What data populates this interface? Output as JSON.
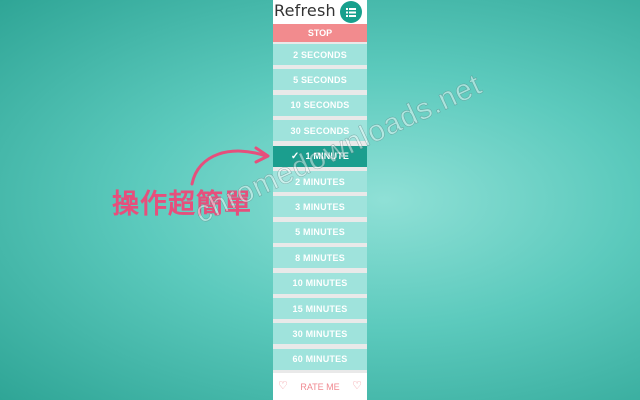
{
  "header": {
    "title": "Refresh",
    "menu_icon": "list-icon"
  },
  "stop_label": "STOP",
  "intervals": [
    {
      "label": "2 SECONDS",
      "active": false
    },
    {
      "label": "5 SECONDS",
      "active": false
    },
    {
      "label": "10 SECONDS",
      "active": false
    },
    {
      "label": "30 SECONDS",
      "active": false
    },
    {
      "label": "1 MINUTE",
      "active": true
    },
    {
      "label": "2 MINUTES",
      "active": false
    },
    {
      "label": "3 MINUTES",
      "active": false
    },
    {
      "label": "5 MINUTES",
      "active": false
    },
    {
      "label": "8 MINUTES",
      "active": false
    },
    {
      "label": "10 MINUTES",
      "active": false
    },
    {
      "label": "15 MINUTES",
      "active": false
    },
    {
      "label": "30 MINUTES",
      "active": false
    },
    {
      "label": "60 MINUTES",
      "active": false
    }
  ],
  "footer": {
    "rate_label": "RATE ME",
    "icon": "heart-icon"
  },
  "side_caption": "操作超簡單",
  "watermark": "chromedownloads.net",
  "colors": {
    "accent": "#17a08d",
    "stop": "#f28b8e",
    "item": "#9fe3dc",
    "active": "#1b9e8e",
    "caption": "#e64f7c"
  }
}
